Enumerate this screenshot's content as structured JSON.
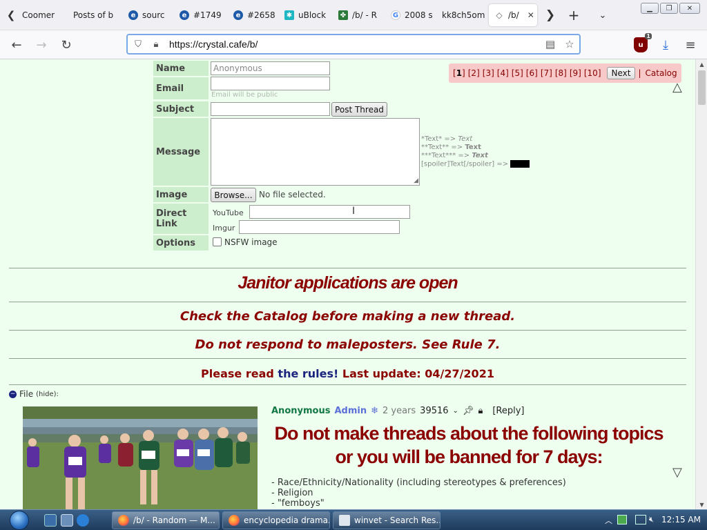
{
  "tabs": [
    {
      "label": "Coomer",
      "icon": "chevron-left"
    },
    {
      "label": "Posts of b",
      "icon": "none"
    },
    {
      "label": "sourc",
      "icon": "edge"
    },
    {
      "label": "#1749",
      "icon": "edge"
    },
    {
      "label": "#2658",
      "icon": "edge"
    },
    {
      "label": "uBlock",
      "icon": "ublock"
    },
    {
      "label": "/b/ - R",
      "icon": "cross"
    },
    {
      "label": "2008 s",
      "icon": "google"
    },
    {
      "label": "kk8ch5om",
      "icon": "none"
    },
    {
      "label": "/b/",
      "icon": "diamond",
      "active": true
    }
  ],
  "nav": {
    "url": "https://crystal.cafe/b/",
    "ublock_count": "1"
  },
  "form": {
    "labels": {
      "name": "Name",
      "email": "Email",
      "subject": "Subject",
      "message": "Message",
      "image": "Image",
      "direct_link": "Direct Link",
      "options": "Options"
    },
    "name_placeholder": "Anonymous",
    "email_note": "Email will be public",
    "post_button": "Post Thread",
    "browse_button": "Browse...",
    "no_file": "No file selected.",
    "youtube_label": "YouTube",
    "imgur_label": "Imgur",
    "nsfw_label": "NSFW image",
    "format_help": [
      {
        "src": "*Text* =>",
        "out": "Text",
        "style": "italic"
      },
      {
        "src": "**Text** =>",
        "out": "Text",
        "style": "bold"
      },
      {
        "src": "***Text*** =>",
        "out": "Text",
        "style": "bolditalic"
      },
      {
        "src": "[spoiler]Text[/spoiler] =>",
        "out": "",
        "style": "spoiler"
      }
    ]
  },
  "pager": {
    "pages": [
      "1",
      "2",
      "3",
      "4",
      "5",
      "6",
      "7",
      "8",
      "9",
      "10"
    ],
    "current": "1",
    "next": "Next",
    "catalog": "Catalog"
  },
  "announcements": {
    "janitor": "Janitor applications are open",
    "catalog_check": "Check the Catalog before making a new thread.",
    "maleposters": "Do not respond to maleposters. See Rule 7.",
    "rules_prefix": "Please read",
    "rules_link": "the rules!",
    "rules_suffix": "Last update: 04/27/2021"
  },
  "thread": {
    "file_label": "File",
    "hide_label": "(hide):",
    "name": "Anonymous",
    "capcode": "Admin",
    "date": "2 years",
    "post_number": "39516",
    "reply": "[Reply]",
    "headline_1": "Do not make threads about the following topics",
    "headline_2": "or you will be banned for 7 days:",
    "rules": [
      "- Race/Ethnicity/Nationality (including stereotypes & preferences)",
      "- Religion",
      "- \"femboys\""
    ]
  },
  "taskbar": {
    "items": [
      {
        "label": "/b/ - Random — M...",
        "icon": "firefox",
        "active": true
      },
      {
        "label": "encyclopedia drama...",
        "icon": "firefox",
        "active": false
      },
      {
        "label": "winvet - Search Res...",
        "icon": "document",
        "active": false
      }
    ],
    "clock": "12:15 AM"
  },
  "colors": {
    "page_bg": "#eefff0",
    "label_bg": "#cdeecd",
    "announce_red": "#8b0000",
    "pager_bg": "#f7c9c9",
    "name_green": "#117743",
    "admin_blue": "#5b6fd8"
  }
}
